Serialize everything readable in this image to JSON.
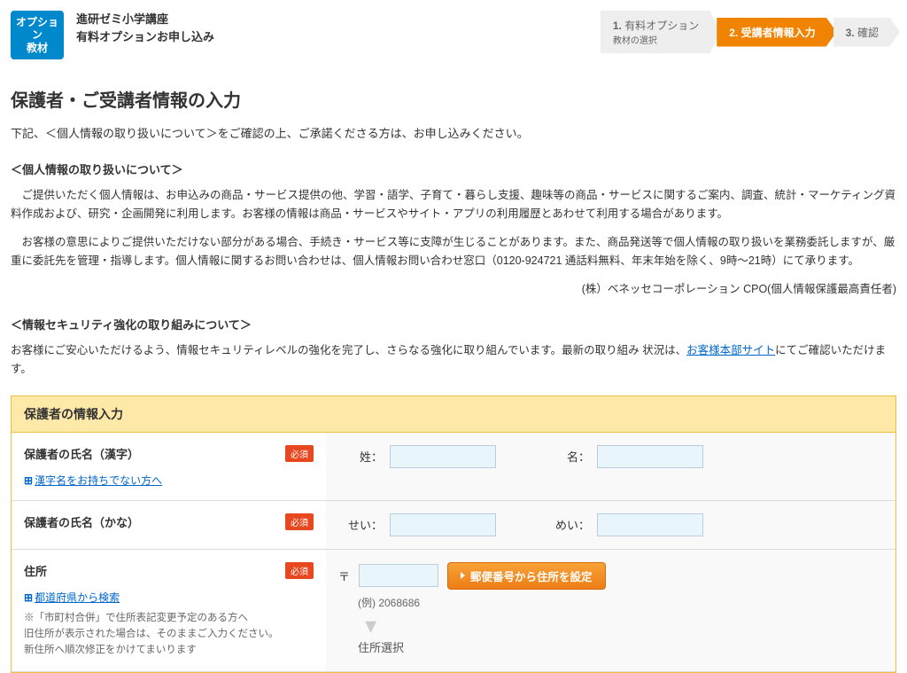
{
  "header": {
    "logo_line1": "オプション",
    "logo_line2": "教材",
    "title_line1": "進研ゼミ小学講座",
    "title_line2": "有料オプションお申し込み"
  },
  "steps": [
    {
      "num": "1.",
      "label": "有料オプション",
      "sub": "教材の選択"
    },
    {
      "num": "2.",
      "label": "受講者情報入力"
    },
    {
      "num": "3.",
      "label": "確認"
    }
  ],
  "page_title": "保護者・ご受講者情報の入力",
  "intro": "下記、＜個人情報の取り扱いについて＞をご確認の上、ご承諾くださる方は、お申し込みください。",
  "privacy": {
    "heading": "＜個人情報の取り扱いについて＞",
    "body1": "ご提供いただく個人情報は、お申込みの商品・サービス提供の他、学習・語学、子育て・暮らし支援、趣味等の商品・サービスに関するご案内、調査、統計・マーケティング資料作成および、研究・企画開発に利用します。お客様の情報は商品・サービスやサイト・アプリの利用履歴とあわせて利用する場合があります。",
    "body2": "お客様の意思によりご提供いただけない部分がある場合、手続き・サービス等に支障が生じることがあります。また、商品発送等で個人情報の取り扱いを業務委託しますが、厳重に委託先を管理・指導します。個人情報に関するお問い合わせは、個人情報お問い合わせ窓口（0120-924721 通話料無料、年末年始を除く、9時～21時）にて承ります。",
    "signature": "(株）ベネッセコーポレーション CPO(個人情報保護最高責任者)"
  },
  "security": {
    "heading": "＜情報セキュリティ強化の取り組みについて＞",
    "body_pre": "お客様にご安心いただけるよう、情報セキュリティレベルの強化を完了し、さらなる強化に取り組んでいます。最新の取り組み 状況は、",
    "link": "お客様本部サイト",
    "body_post": "にてご確認いただけます。"
  },
  "form": {
    "section_title": "保護者の情報入力",
    "required_label": "必須",
    "rows": {
      "kanji": {
        "label": "保護者の氏名（漢字）",
        "sei": "姓：",
        "mei": "名：",
        "sublink": "漢字名をお持ちでない方へ"
      },
      "kana": {
        "label": "保護者の氏名（かな）",
        "sei": "せい：",
        "mei": "めい："
      },
      "address": {
        "label": "住所",
        "postal_mark": "〒",
        "button": "郵便番号から住所を設定",
        "example": "(例) 2068686",
        "sublink": "都道府県から検索",
        "note": "※「市町村合併」で住所表記変更予定のある方へ\n旧住所が表示された場合は、そのままご入力ください。\n新住所へ順次修正をかけてまいります",
        "address_select": "住所選択"
      }
    }
  }
}
